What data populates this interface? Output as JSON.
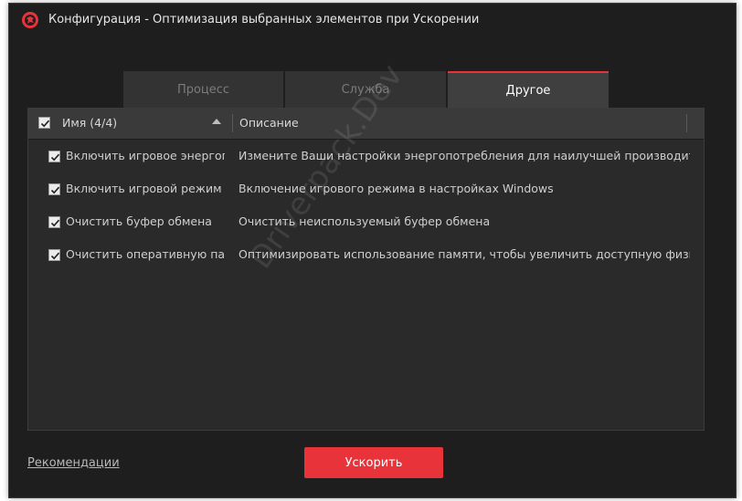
{
  "window": {
    "title": "Конфигурация - Оптимизация выбранных элементов при Ускорении",
    "logo_icon": "iobit-logo-icon"
  },
  "tabs": [
    {
      "label": "Процесс",
      "active": false
    },
    {
      "label": "Служба",
      "active": false
    },
    {
      "label": "Другое",
      "active": true
    }
  ],
  "table": {
    "header": {
      "name": "Имя (4/4)",
      "description": "Описание",
      "select_all_checked": true
    },
    "rows": [
      {
        "checked": true,
        "name": "Включить игровое энергоп...",
        "description": "Измените Ваши настройки энергопотребления для наилучшей производитель..."
      },
      {
        "checked": true,
        "name": "Включить игровой режим ...",
        "description": "Включение игрового режима в настройках Windows"
      },
      {
        "checked": true,
        "name": "Очистить буфер обмена",
        "description": "Очистить неиспользуемый буфер обмена"
      },
      {
        "checked": true,
        "name": "Очистить оперативную пам...",
        "description": "Оптимизировать использование памяти, чтобы увеличить доступную физическ..."
      }
    ]
  },
  "watermark": "Driverpack.Dev",
  "footer": {
    "recommendations_link": "Рекомендации",
    "boost_button": "Ускорить"
  },
  "colors": {
    "accent": "#e8333a",
    "background": "#1e1e1e"
  }
}
